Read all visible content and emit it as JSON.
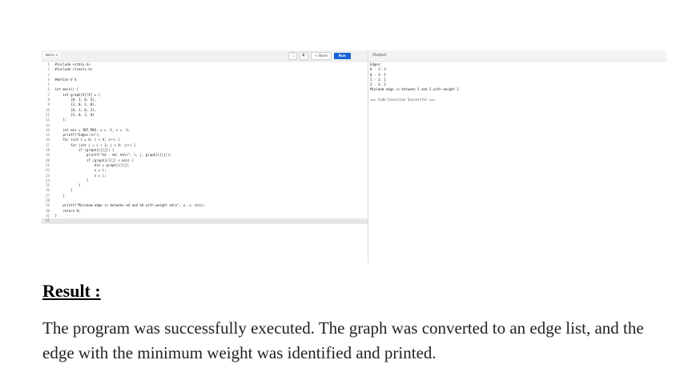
{
  "editor": {
    "file_tab": "main.c",
    "toolbar": {
      "share_label": "Share",
      "run_label": "Run",
      "icons": [
        "fullscreen-icon",
        "theme-icon",
        "share-icon"
      ]
    },
    "lines": [
      {
        "n": "1",
        "text": " #include <stdio.h>"
      },
      {
        "n": "2",
        "text": " #include <limits.h>"
      },
      {
        "n": "3",
        "text": ""
      },
      {
        "n": "4",
        "text": " #define V 4"
      },
      {
        "n": "5",
        "text": ""
      },
      {
        "n": "6",
        "text": " int main() {"
      },
      {
        "n": "7",
        "text": "     int graph[V][V] = {"
      },
      {
        "n": "8",
        "text": "         {0, 3, 0, 5},"
      },
      {
        "n": "9",
        "text": "         {3, 0, 1, 0},"
      },
      {
        "n": "10",
        "text": "         {0, 1, 0, 2},"
      },
      {
        "n": "11",
        "text": "         {5, 0, 2, 0}"
      },
      {
        "n": "12",
        "text": "     };"
      },
      {
        "n": "13",
        "text": ""
      },
      {
        "n": "14",
        "text": "     int min = INT_MAX, u = -1, v = -1;"
      },
      {
        "n": "15",
        "text": "     printf(\"Edges:\\n\");"
      },
      {
        "n": "16",
        "text": "     for (int i = 0; i < V; i++) {"
      },
      {
        "n": "17",
        "text": "         for (int j = i + 1; j < V; j++) {"
      },
      {
        "n": "18",
        "text": "             if (graph[i][j]) {"
      },
      {
        "n": "19",
        "text": "                 printf(\"%d - %d: %d\\n\", i, j, graph[i][j]);"
      },
      {
        "n": "20",
        "text": "                 if (graph[i][j] < min) {"
      },
      {
        "n": "21",
        "text": "                     min = graph[i][j];"
      },
      {
        "n": "22",
        "text": "                     u = i;"
      },
      {
        "n": "23",
        "text": "                     v = j;"
      },
      {
        "n": "24",
        "text": "                 }"
      },
      {
        "n": "25",
        "text": "             }"
      },
      {
        "n": "26",
        "text": "         }"
      },
      {
        "n": "27",
        "text": "     }"
      },
      {
        "n": "28",
        "text": ""
      },
      {
        "n": "29",
        "text": "     printf(\"Minimum edge is between %d and %d with weight %d\\n\", u, v, min);"
      },
      {
        "n": "30",
        "text": "     return 0;"
      },
      {
        "n": "31",
        "text": " }"
      },
      {
        "n": "32",
        "text": ""
      }
    ]
  },
  "output": {
    "title": "Output",
    "lines": [
      "Edges:",
      "0 - 1: 3",
      "0 - 3: 5",
      "1 - 2: 1",
      "2 - 3: 2",
      "Minimum edge is between 1 and 2 with weight 1"
    ],
    "status": "=== Code Execution Successful ==="
  },
  "result": {
    "heading": "Result :",
    "text": "The program was successfully executed. The graph was converted to an edge list, and the edge with the minimum weight was identified and printed."
  }
}
